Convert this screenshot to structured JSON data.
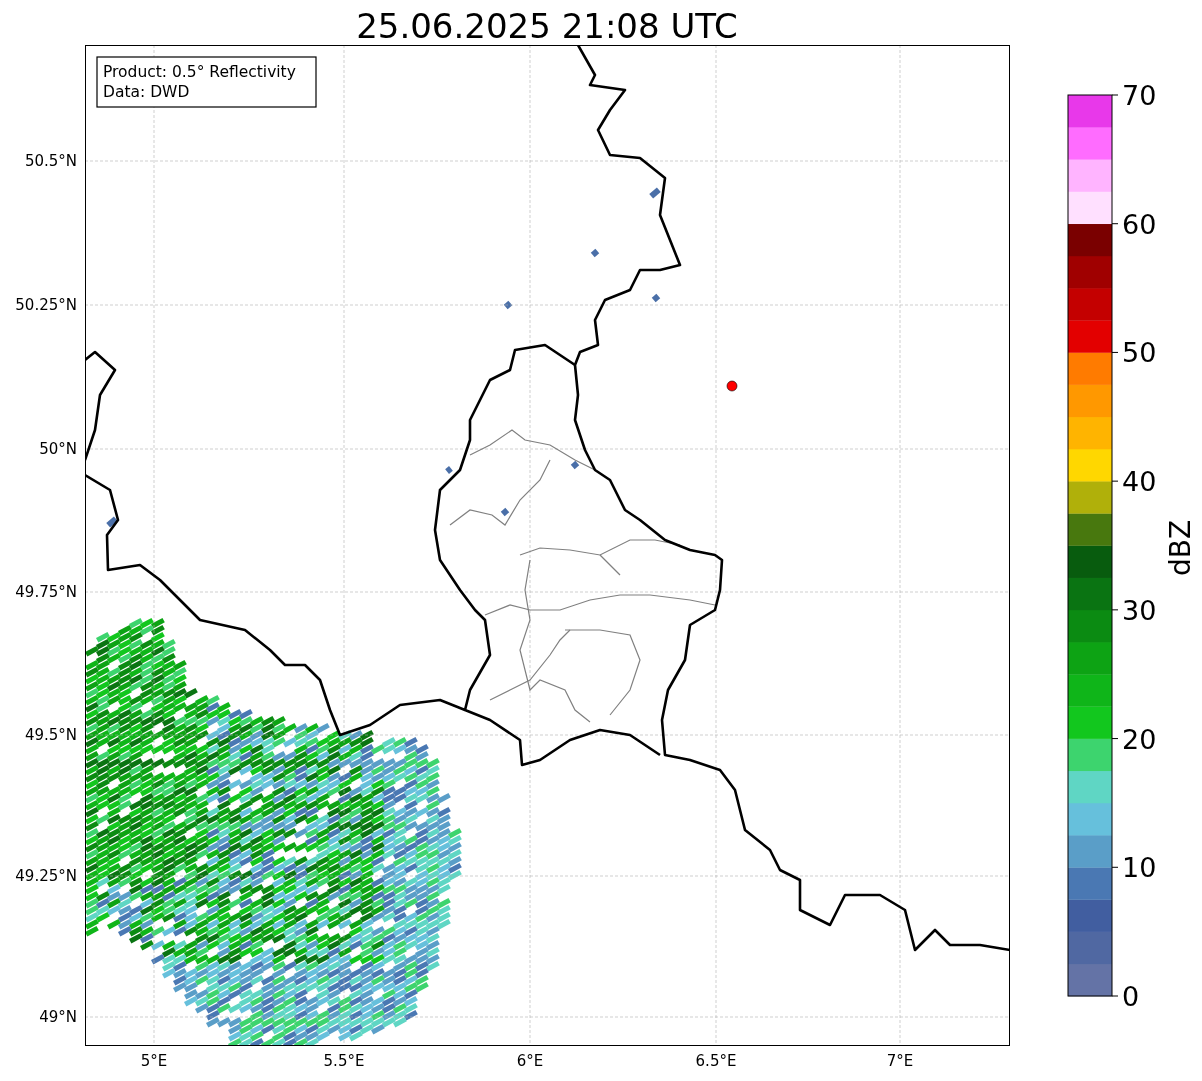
{
  "title": "25.06.2025 21:08 UTC",
  "info_box": [
    "Product: 0.5° Reflectivity",
    "Data: DWD"
  ],
  "map": {
    "x_ticks": [
      "5°E",
      "5.5°E",
      "6°E",
      "6.5°E",
      "7°E"
    ],
    "y_ticks": [
      "50.5°N",
      "50.25°N",
      "50°N",
      "49.75°N",
      "49.5°N",
      "49.25°N",
      "49°N"
    ],
    "marker": {
      "color": "#ff0000"
    }
  },
  "colorbar": {
    "label": "dBZ",
    "ticks": [
      "70",
      "60",
      "50",
      "40",
      "30",
      "20",
      "10",
      "0"
    ],
    "segments": [
      {
        "color": "#6473a6"
      },
      {
        "color": "#5068a2"
      },
      {
        "color": "#415ea0"
      },
      {
        "color": "#4a78b3"
      },
      {
        "color": "#5a9ec8"
      },
      {
        "color": "#66c0dc"
      },
      {
        "color": "#5fd6c4"
      },
      {
        "color": "#3dd46e"
      },
      {
        "color": "#12c71e"
      },
      {
        "color": "#0fb519"
      },
      {
        "color": "#0da314"
      },
      {
        "color": "#0b8b12"
      },
      {
        "color": "#0a7412"
      },
      {
        "color": "#085c0e"
      },
      {
        "color": "#48780e"
      },
      {
        "color": "#b0b00a"
      },
      {
        "color": "#ffd700"
      },
      {
        "color": "#ffb400"
      },
      {
        "color": "#ff9800"
      },
      {
        "color": "#ff7b00"
      },
      {
        "color": "#e30000"
      },
      {
        "color": "#c40000"
      },
      {
        "color": "#a00000"
      },
      {
        "color": "#7a0000"
      },
      {
        "color": "#ffe0ff"
      },
      {
        "color": "#ffb4ff"
      },
      {
        "color": "#ff6cff"
      },
      {
        "color": "#e838ea"
      }
    ]
  }
}
